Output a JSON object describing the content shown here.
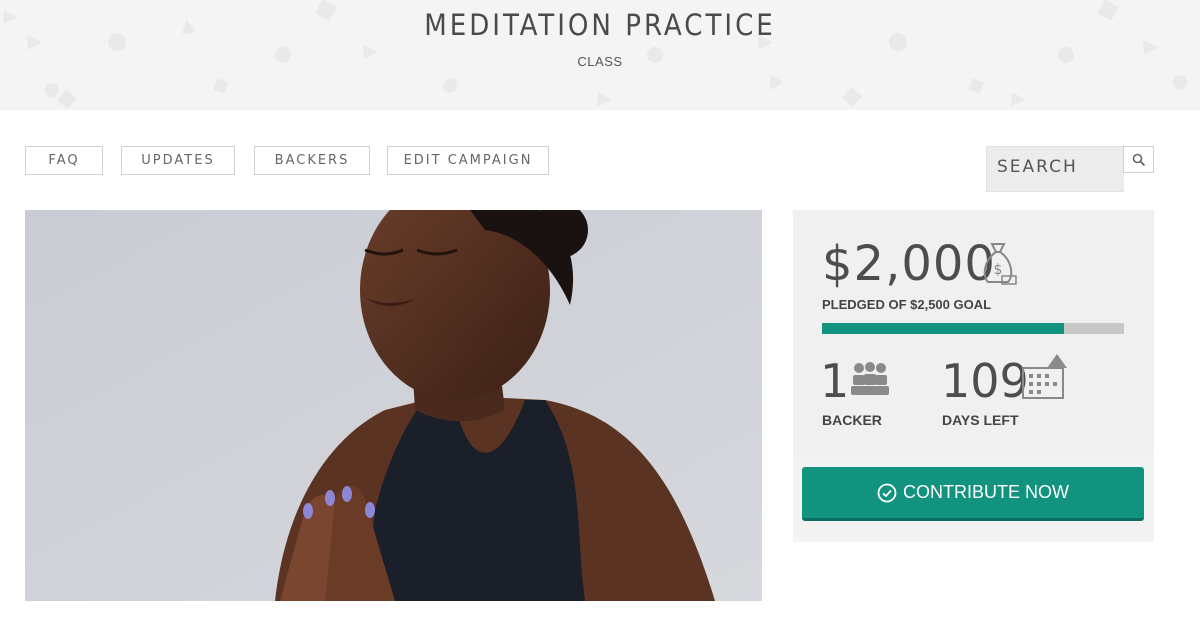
{
  "header": {
    "title": "MEDITATION PRACTICE",
    "subtitle": "CLASS"
  },
  "nav": {
    "items": [
      {
        "label": "FAQ"
      },
      {
        "label": "UPDATES"
      },
      {
        "label": "BACKERS"
      },
      {
        "label": "EDIT CAMPAIGN"
      }
    ]
  },
  "search": {
    "placeholder": "SEARCH",
    "icon": "search-icon"
  },
  "hero": {
    "icon": "hero-photo-meditating-woman"
  },
  "campaign": {
    "pledged_amount": "$2,000",
    "pledged_label": "PLEDGED OF $2,500 GOAL",
    "progress_fraction": 0.8,
    "backers_count": "1",
    "backers_label": "BACKER",
    "days_left": "109",
    "days_left_label": "DAYS LEFT",
    "contribute_label": "CONTRIBUTE NOW"
  },
  "colors": {
    "accent": "#12937f",
    "progress_track": "#c7c7c7",
    "header_bg": "#f4f4f4"
  }
}
